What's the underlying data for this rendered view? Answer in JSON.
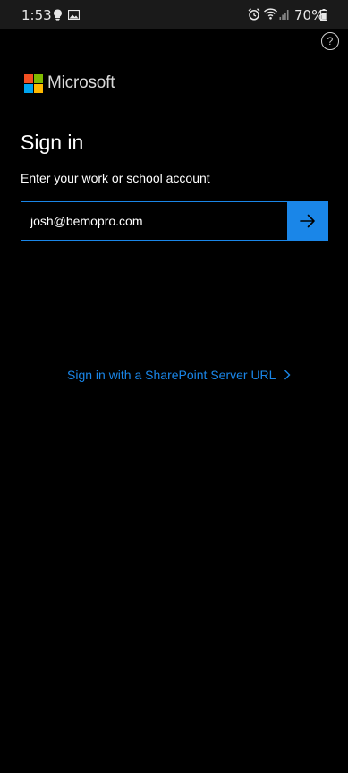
{
  "status_bar": {
    "time": "1:53",
    "battery_percent": "70%",
    "icons": [
      "bulb-icon",
      "image-icon",
      "alarm-icon",
      "wifi-icon",
      "signal-icon",
      "battery-icon"
    ]
  },
  "header": {
    "help_label": "?",
    "brand_name": "Microsoft"
  },
  "signin": {
    "title": "Sign in",
    "subtitle": "Enter your work or school account",
    "email_value": "josh@bemopro.com",
    "next_icon": "arrow-right-icon"
  },
  "links": {
    "sharepoint_label": "Sign in with a SharePoint Server URL"
  },
  "colors": {
    "accent": "#1a86e8",
    "background": "#000000",
    "ms_red": "#f25022",
    "ms_green": "#7fba00",
    "ms_blue": "#00a4ef",
    "ms_yellow": "#ffb900"
  }
}
